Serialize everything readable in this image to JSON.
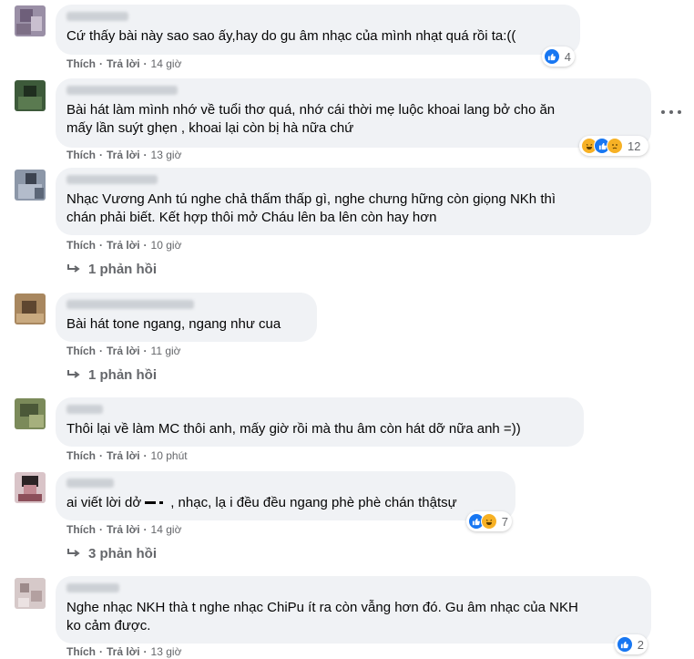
{
  "actions": {
    "like": "Thích",
    "reply": "Trả lời",
    "separator": "·"
  },
  "comments": [
    {
      "text": "Cứ thấy bài này sao sao ấy,hay do gu âm nhạc của mình nhạt quá rồi ta:((",
      "time": "14 giờ",
      "reaction_count": "4"
    },
    {
      "text": "Bài hát làm mình nhớ về tuổi thơ quá, nhớ cái thời mẹ luộc khoai lang bở cho ăn\nmấy lần suýt ghẹn , khoai lại còn bị hà nữa chứ",
      "time": "13 giờ",
      "reaction_count": "12"
    },
    {
      "text": "Nhạc Vương Anh tú nghe chả thấm thấp gì, nghe chưng hững còn giọng NKh thì\nchán phải biết. Kết hợp thôi mở Cháu lên ba lên còn hay hơn",
      "time": "10 giờ",
      "replies": "1 phản hồi"
    },
    {
      "text": "Bài hát tone ngang, ngang như cua",
      "time": "11 giờ",
      "replies": "1 phản hồi"
    },
    {
      "text": "Thôi lại về làm MC thôi anh, mấy giờ rồi mà thu âm còn hát dỡ nữa anh =))",
      "time": "10 phút"
    },
    {
      "text_before": "ai viết lời dở",
      "text_after": ", nhạc, lạ i đều đều ngang phè phè chán thậtsự",
      "time": "14 giờ",
      "reaction_count": "7",
      "replies": "3 phản hồi"
    },
    {
      "text": "Nghe nhạc NKH thà t nghe nhạc ChiPu ít ra còn vẫng hơn đó. Gu âm nhạc của NKH\nko cảm được.",
      "time": "13 giờ",
      "reaction_count": "2"
    }
  ],
  "colors": {
    "bubble": "#f0f2f5",
    "meta": "#65676b",
    "like_blue": "#1877f2",
    "haha_yellow": "#f7b125"
  },
  "icons": {
    "more": "more-horizontal-icon",
    "reply_arrow": "reply-arrow-icon",
    "like": "like-reaction-icon",
    "haha": "haha-reaction-icon",
    "sad": "sad-reaction-icon"
  }
}
